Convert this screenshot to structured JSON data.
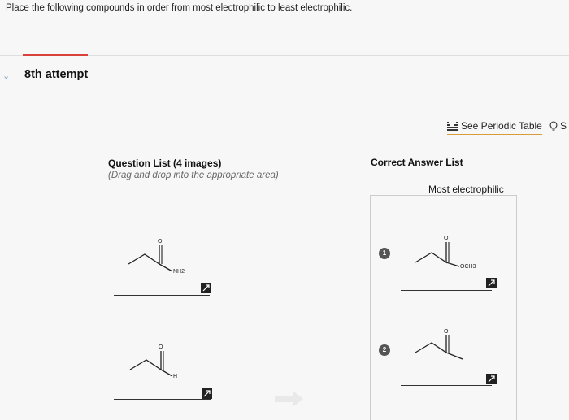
{
  "instruction": "Place the following compounds in order from most electrophilic to least electrophilic.",
  "attempt": {
    "label": "8th attempt"
  },
  "toolbar": {
    "periodic_table_label": "See Periodic Table",
    "hint_label": "S"
  },
  "question_list": {
    "title": "Question List (4 images)",
    "subtitle": "(Drag and drop into the appropriate area)",
    "items": [
      {
        "label": "NH2",
        "icon": "expand-icon"
      },
      {
        "label": "H",
        "icon": "expand-icon"
      }
    ]
  },
  "answer_list": {
    "title": "Correct Answer List",
    "top_label": "Most electrophilic",
    "items": [
      {
        "rank": "1",
        "label": "OCH3",
        "icon": "expand-icon"
      },
      {
        "rank": "2",
        "label": "",
        "icon": "expand-icon"
      }
    ]
  },
  "colors": {
    "accent_red": "#d9413b",
    "link_underline": "#d79c3c"
  }
}
